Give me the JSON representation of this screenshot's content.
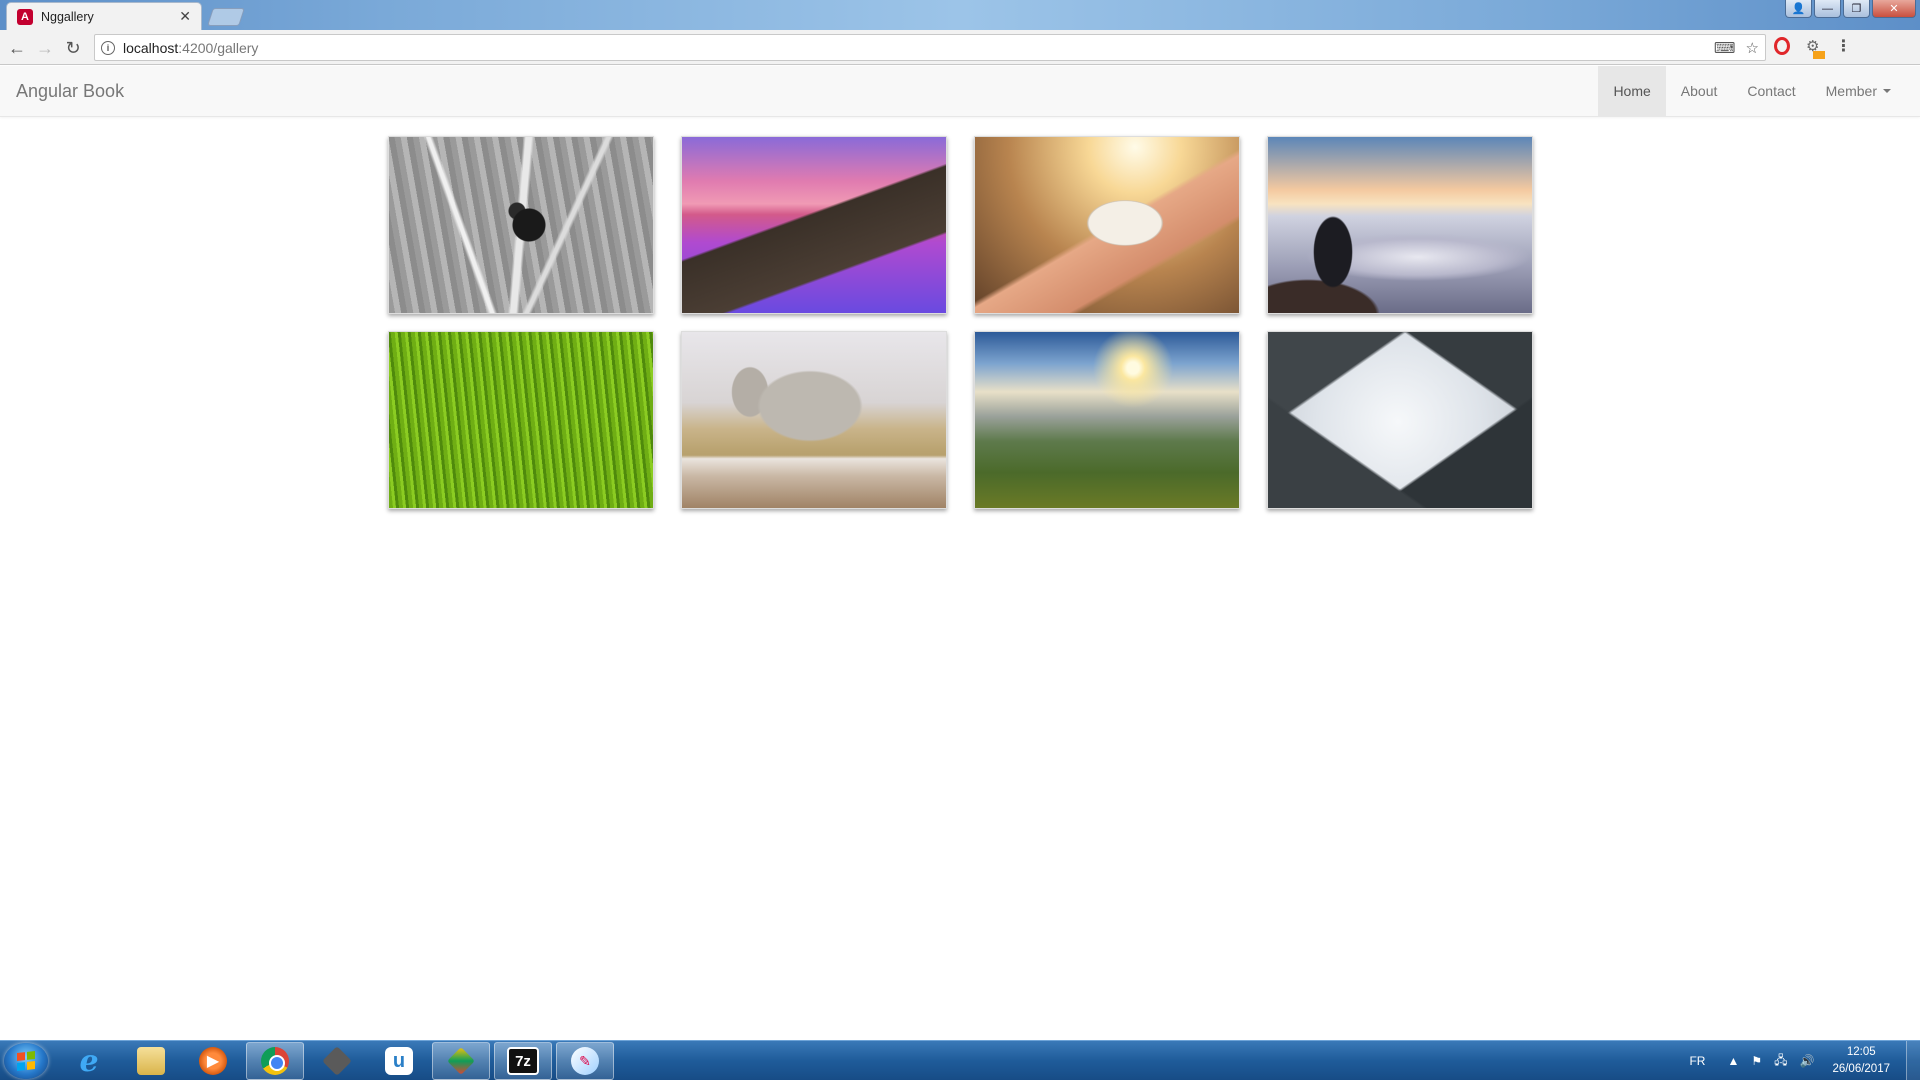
{
  "browser": {
    "tab": {
      "title": "Nggallery",
      "favicon": "A"
    },
    "url_host": "localhost",
    "url_path": ":4200/gallery",
    "window_controls": {
      "minimize": "—",
      "maximize": "❐",
      "close": "✕"
    }
  },
  "navbar": {
    "brand": "Angular Book",
    "links": [
      {
        "label": "Home",
        "active": true
      },
      {
        "label": "About",
        "active": false
      },
      {
        "label": "Contact",
        "active": false
      },
      {
        "label": "Member",
        "active": false,
        "dropdown": true
      }
    ]
  },
  "gallery": {
    "images": [
      {
        "name": "gallery-image-ladybug"
      },
      {
        "name": "gallery-image-pier-sunset"
      },
      {
        "name": "gallery-image-phone-photo"
      },
      {
        "name": "gallery-image-man-above-clouds"
      },
      {
        "name": "gallery-image-green-grass"
      },
      {
        "name": "gallery-image-elephant"
      },
      {
        "name": "gallery-image-hills-sunset"
      },
      {
        "name": "gallery-image-skyscrapers"
      }
    ]
  },
  "taskbar": {
    "apps": [
      "internet-explorer",
      "file-explorer",
      "media-player",
      "chrome",
      "box-app",
      "ultraedit",
      "diamond-app",
      "7zip",
      "paint"
    ],
    "language": "FR",
    "time": "12:05",
    "date": "26/06/2017"
  },
  "colors": {
    "navbar_bg": "#f8f8f8",
    "nav_active_bg": "#e7e7e7",
    "taskbar": "#1f5c9a"
  }
}
